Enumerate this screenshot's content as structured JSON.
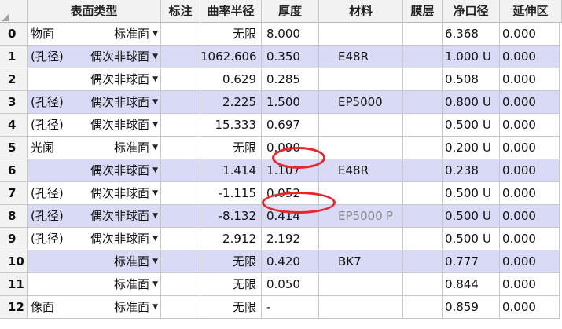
{
  "columns": {
    "surface_type": "表面类型",
    "comment": "标注",
    "radius": "曲率半径",
    "thickness": "厚度",
    "material": "材料",
    "coating": "膜层",
    "clear_semi_dia": "净口径",
    "extend": "延伸区"
  },
  "dropdown_glyph": "▼",
  "rows": [
    {
      "idx": "0",
      "name": "物面",
      "type": "标准面",
      "radius": "无限",
      "thickness": "8.000",
      "material": "",
      "mat_flag": "",
      "semi": "6.368",
      "semi_flag": "",
      "extend": "0.000"
    },
    {
      "idx": "1",
      "name": "(孔径)",
      "type": "偶次非球面",
      "radius": "1062.606",
      "thickness": "0.350",
      "material": "E48R",
      "mat_flag": "",
      "semi": "1.000",
      "semi_flag": "U",
      "extend": "0.000"
    },
    {
      "idx": "2",
      "name": "",
      "type": "偶次非球面",
      "radius": "0.629",
      "thickness": "0.285",
      "material": "",
      "mat_flag": "",
      "semi": "0.508",
      "semi_flag": "",
      "extend": "0.000"
    },
    {
      "idx": "3",
      "name": "(孔径)",
      "type": "偶次非球面",
      "radius": "2.225",
      "thickness": "1.500",
      "material": "EP5000",
      "mat_flag": "",
      "semi": "0.800",
      "semi_flag": "U",
      "extend": "0.000"
    },
    {
      "idx": "4",
      "name": "(孔径)",
      "type": "偶次非球面",
      "radius": "15.333",
      "thickness": "0.697",
      "material": "",
      "mat_flag": "",
      "semi": "0.500",
      "semi_flag": "U",
      "extend": "0.000"
    },
    {
      "idx": "5",
      "name": "光阑",
      "type": "标准面",
      "radius": "无限",
      "thickness": "0.090",
      "material": "",
      "mat_flag": "",
      "semi": "0.200",
      "semi_flag": "U",
      "extend": "0.000"
    },
    {
      "idx": "6",
      "name": "",
      "type": "偶次非球面",
      "radius": "1.414",
      "thickness": "1.107",
      "material": "E48R",
      "mat_flag": "",
      "semi": "0.238",
      "semi_flag": "",
      "extend": "0.000"
    },
    {
      "idx": "7",
      "name": "(孔径)",
      "type": "偶次非球面",
      "radius": "-1.115",
      "thickness": "0.052",
      "material": "",
      "mat_flag": "",
      "semi": "0.500",
      "semi_flag": "U",
      "extend": "0.000"
    },
    {
      "idx": "8",
      "name": "(孔径)",
      "type": "偶次非球面",
      "radius": "-8.132",
      "thickness": "0.414",
      "material": "EP5000",
      "mat_flag": "P",
      "semi": "0.500",
      "semi_flag": "U",
      "extend": "0.000"
    },
    {
      "idx": "9",
      "name": "(孔径)",
      "type": "偶次非球面",
      "radius": "2.912",
      "thickness": "2.192",
      "material": "",
      "mat_flag": "",
      "semi": "0.500",
      "semi_flag": "U",
      "extend": "0.000"
    },
    {
      "idx": "10",
      "name": "",
      "type": "标准面",
      "radius": "无限",
      "thickness": "0.420",
      "material": "BK7",
      "mat_flag": "",
      "semi": "0.777",
      "semi_flag": "",
      "extend": "0.000"
    },
    {
      "idx": "11",
      "name": "",
      "type": "标准面",
      "radius": "无限",
      "thickness": "0.050",
      "material": "",
      "mat_flag": "",
      "semi": "0.844",
      "semi_flag": "",
      "extend": "0.000"
    },
    {
      "idx": "12",
      "name": "像面",
      "type": "标准面",
      "radius": "无限",
      "thickness": "-",
      "material": "",
      "mat_flag": "",
      "semi": "0.859",
      "semi_flag": "",
      "extend": "0.000"
    }
  ],
  "highlighted_rows": [
    "1",
    "3",
    "6",
    "8",
    "10"
  ],
  "circled_cells": [
    "5.thickness",
    "7.thickness"
  ],
  "colors": {
    "row_highlight": "#d9daf5",
    "annotation_circle": "#e8262b",
    "muted_material": "#888888"
  }
}
